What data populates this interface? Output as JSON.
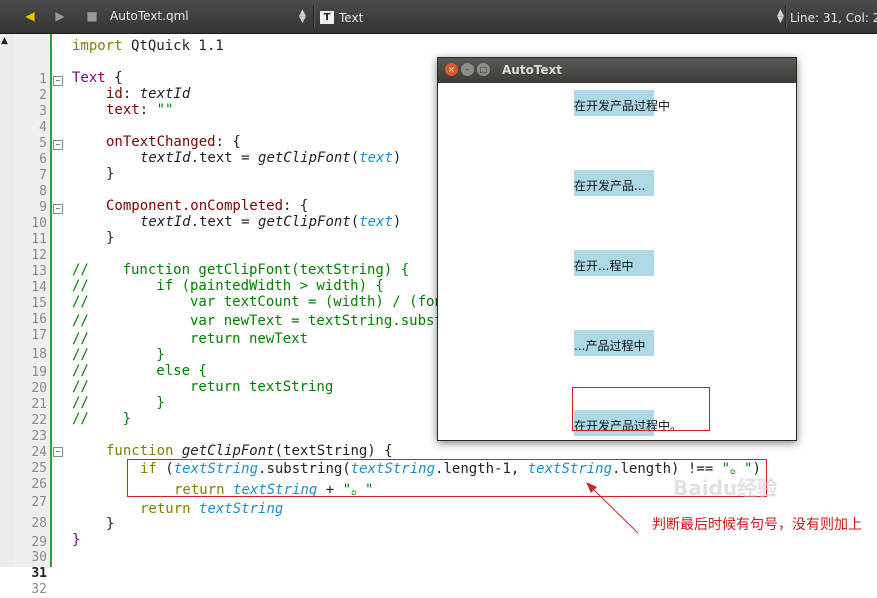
{
  "toolbar": {
    "file_name": "AutoText.qml",
    "symbol": "Text",
    "symbol_glyph": "T",
    "position": "Line: 31, Col: 2"
  },
  "editor": {
    "current_line": 31,
    "lines": [
      {
        "n": "1"
      },
      {
        "n": "2"
      },
      {
        "n": "3"
      },
      {
        "n": "4"
      },
      {
        "n": "5"
      },
      {
        "n": "6"
      },
      {
        "n": "7"
      },
      {
        "n": "8"
      },
      {
        "n": "9"
      },
      {
        "n": "10"
      },
      {
        "n": "11"
      },
      {
        "n": "12"
      },
      {
        "n": "13"
      },
      {
        "n": "14"
      },
      {
        "n": "15"
      },
      {
        "n": "16"
      },
      {
        "n": "17"
      },
      {
        "n": "18"
      },
      {
        "n": "19"
      },
      {
        "n": "20"
      },
      {
        "n": "21"
      },
      {
        "n": "22"
      },
      {
        "n": "23"
      },
      {
        "n": "24"
      },
      {
        "n": "25"
      },
      {
        "n": "26"
      },
      {
        "n": "27"
      },
      {
        "n": "28"
      },
      {
        "n": "29"
      },
      {
        "n": "30"
      },
      {
        "n": "31"
      },
      {
        "n": "32"
      }
    ],
    "code": {
      "l1_kw": "import",
      "l1_rest": " QtQuick 1.1",
      "l3_type": "Text",
      "l3_rest": " {",
      "l4_prop": "id",
      "l4_sep": ": ",
      "l4_val": "textId",
      "l5_prop": "text",
      "l5_sep": ": ",
      "l5_val": "\"\"",
      "l7_prop": "onTextChanged",
      "l7_rest": ": {",
      "l8_obj": "textId",
      "l8_mid": ".text = ",
      "l8_fn": "getClipFont",
      "l8_open": "(",
      "l8_arg": "text",
      "l8_close": ")",
      "l9": "}",
      "l11_prop": "Component.onCompleted",
      "l11_rest": ": {",
      "l12_obj": "textId",
      "l12_mid": ".text = ",
      "l12_fn": "getClipFont",
      "l12_open": "(",
      "l12_arg": "text",
      "l12_close": ")",
      "l13": "}",
      "l15": "//    function getClipFont(textString) {",
      "l16": "//        if (paintedWidth > width) {",
      "l17": "//            var textCount = (width) / (fon",
      "l18": "//            var newText = textString.subst",
      "l19": "//            return newText",
      "l20": "//        }",
      "l21": "//        else {",
      "l22": "//            return textString",
      "l23": "//        }",
      "l24": "//    }",
      "l26_kw": "function",
      "l26_fn": "getClipFont",
      "l26_rest": "(textString) {",
      "l27_kw": "if",
      "l27_a": " (",
      "l27_p1": "textString",
      "l27_b": ".substring(",
      "l27_p2": "textString",
      "l27_c": ".length-1, ",
      "l27_p3": "textString",
      "l27_d": ".length) !== ",
      "l27_str": "\"。\"",
      "l27_e": ")",
      "l28_kw": "return",
      "l28_a": " ",
      "l28_p": "textString",
      "l28_b": " + ",
      "l28_str": "\"。\"",
      "l29_kw": "return",
      "l29_a": " ",
      "l29_p": "textString",
      "l30": "}",
      "l31": "}"
    }
  },
  "window": {
    "title": "AutoText",
    "items": [
      "在开发产品过程中",
      "在开发产品...",
      "在开...程中",
      "...产品过程中",
      "在开发产品过程中。"
    ]
  },
  "annotation": {
    "note": "判断最后时候有句号，没有则加上"
  },
  "watermark": "Baidu经验",
  "colors": {
    "accent_green": "#31a131",
    "highlight_red": "#d42020",
    "textbox_blue": "#add8e6"
  }
}
